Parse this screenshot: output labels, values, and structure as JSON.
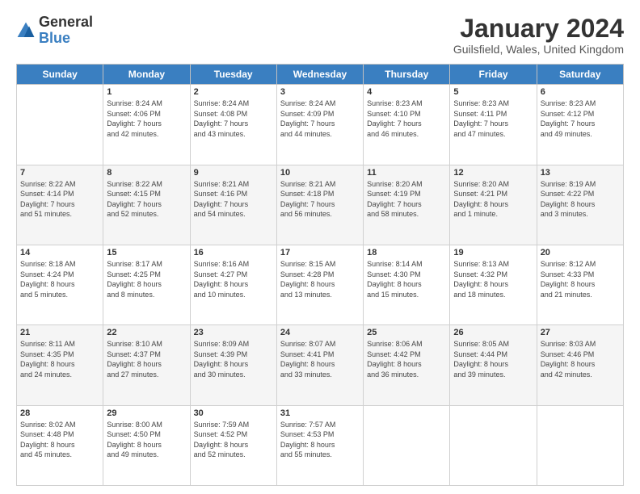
{
  "header": {
    "logo_general": "General",
    "logo_blue": "Blue",
    "month_title": "January 2024",
    "location": "Guilsfield, Wales, United Kingdom"
  },
  "days_of_week": [
    "Sunday",
    "Monday",
    "Tuesday",
    "Wednesday",
    "Thursday",
    "Friday",
    "Saturday"
  ],
  "weeks": [
    [
      {
        "day": "",
        "info": ""
      },
      {
        "day": "1",
        "info": "Sunrise: 8:24 AM\nSunset: 4:06 PM\nDaylight: 7 hours\nand 42 minutes."
      },
      {
        "day": "2",
        "info": "Sunrise: 8:24 AM\nSunset: 4:08 PM\nDaylight: 7 hours\nand 43 minutes."
      },
      {
        "day": "3",
        "info": "Sunrise: 8:24 AM\nSunset: 4:09 PM\nDaylight: 7 hours\nand 44 minutes."
      },
      {
        "day": "4",
        "info": "Sunrise: 8:23 AM\nSunset: 4:10 PM\nDaylight: 7 hours\nand 46 minutes."
      },
      {
        "day": "5",
        "info": "Sunrise: 8:23 AM\nSunset: 4:11 PM\nDaylight: 7 hours\nand 47 minutes."
      },
      {
        "day": "6",
        "info": "Sunrise: 8:23 AM\nSunset: 4:12 PM\nDaylight: 7 hours\nand 49 minutes."
      }
    ],
    [
      {
        "day": "7",
        "info": "Sunrise: 8:22 AM\nSunset: 4:14 PM\nDaylight: 7 hours\nand 51 minutes."
      },
      {
        "day": "8",
        "info": "Sunrise: 8:22 AM\nSunset: 4:15 PM\nDaylight: 7 hours\nand 52 minutes."
      },
      {
        "day": "9",
        "info": "Sunrise: 8:21 AM\nSunset: 4:16 PM\nDaylight: 7 hours\nand 54 minutes."
      },
      {
        "day": "10",
        "info": "Sunrise: 8:21 AM\nSunset: 4:18 PM\nDaylight: 7 hours\nand 56 minutes."
      },
      {
        "day": "11",
        "info": "Sunrise: 8:20 AM\nSunset: 4:19 PM\nDaylight: 7 hours\nand 58 minutes."
      },
      {
        "day": "12",
        "info": "Sunrise: 8:20 AM\nSunset: 4:21 PM\nDaylight: 8 hours\nand 1 minute."
      },
      {
        "day": "13",
        "info": "Sunrise: 8:19 AM\nSunset: 4:22 PM\nDaylight: 8 hours\nand 3 minutes."
      }
    ],
    [
      {
        "day": "14",
        "info": "Sunrise: 8:18 AM\nSunset: 4:24 PM\nDaylight: 8 hours\nand 5 minutes."
      },
      {
        "day": "15",
        "info": "Sunrise: 8:17 AM\nSunset: 4:25 PM\nDaylight: 8 hours\nand 8 minutes."
      },
      {
        "day": "16",
        "info": "Sunrise: 8:16 AM\nSunset: 4:27 PM\nDaylight: 8 hours\nand 10 minutes."
      },
      {
        "day": "17",
        "info": "Sunrise: 8:15 AM\nSunset: 4:28 PM\nDaylight: 8 hours\nand 13 minutes."
      },
      {
        "day": "18",
        "info": "Sunrise: 8:14 AM\nSunset: 4:30 PM\nDaylight: 8 hours\nand 15 minutes."
      },
      {
        "day": "19",
        "info": "Sunrise: 8:13 AM\nSunset: 4:32 PM\nDaylight: 8 hours\nand 18 minutes."
      },
      {
        "day": "20",
        "info": "Sunrise: 8:12 AM\nSunset: 4:33 PM\nDaylight: 8 hours\nand 21 minutes."
      }
    ],
    [
      {
        "day": "21",
        "info": "Sunrise: 8:11 AM\nSunset: 4:35 PM\nDaylight: 8 hours\nand 24 minutes."
      },
      {
        "day": "22",
        "info": "Sunrise: 8:10 AM\nSunset: 4:37 PM\nDaylight: 8 hours\nand 27 minutes."
      },
      {
        "day": "23",
        "info": "Sunrise: 8:09 AM\nSunset: 4:39 PM\nDaylight: 8 hours\nand 30 minutes."
      },
      {
        "day": "24",
        "info": "Sunrise: 8:07 AM\nSunset: 4:41 PM\nDaylight: 8 hours\nand 33 minutes."
      },
      {
        "day": "25",
        "info": "Sunrise: 8:06 AM\nSunset: 4:42 PM\nDaylight: 8 hours\nand 36 minutes."
      },
      {
        "day": "26",
        "info": "Sunrise: 8:05 AM\nSunset: 4:44 PM\nDaylight: 8 hours\nand 39 minutes."
      },
      {
        "day": "27",
        "info": "Sunrise: 8:03 AM\nSunset: 4:46 PM\nDaylight: 8 hours\nand 42 minutes."
      }
    ],
    [
      {
        "day": "28",
        "info": "Sunrise: 8:02 AM\nSunset: 4:48 PM\nDaylight: 8 hours\nand 45 minutes."
      },
      {
        "day": "29",
        "info": "Sunrise: 8:00 AM\nSunset: 4:50 PM\nDaylight: 8 hours\nand 49 minutes."
      },
      {
        "day": "30",
        "info": "Sunrise: 7:59 AM\nSunset: 4:52 PM\nDaylight: 8 hours\nand 52 minutes."
      },
      {
        "day": "31",
        "info": "Sunrise: 7:57 AM\nSunset: 4:53 PM\nDaylight: 8 hours\nand 55 minutes."
      },
      {
        "day": "",
        "info": ""
      },
      {
        "day": "",
        "info": ""
      },
      {
        "day": "",
        "info": ""
      }
    ]
  ]
}
